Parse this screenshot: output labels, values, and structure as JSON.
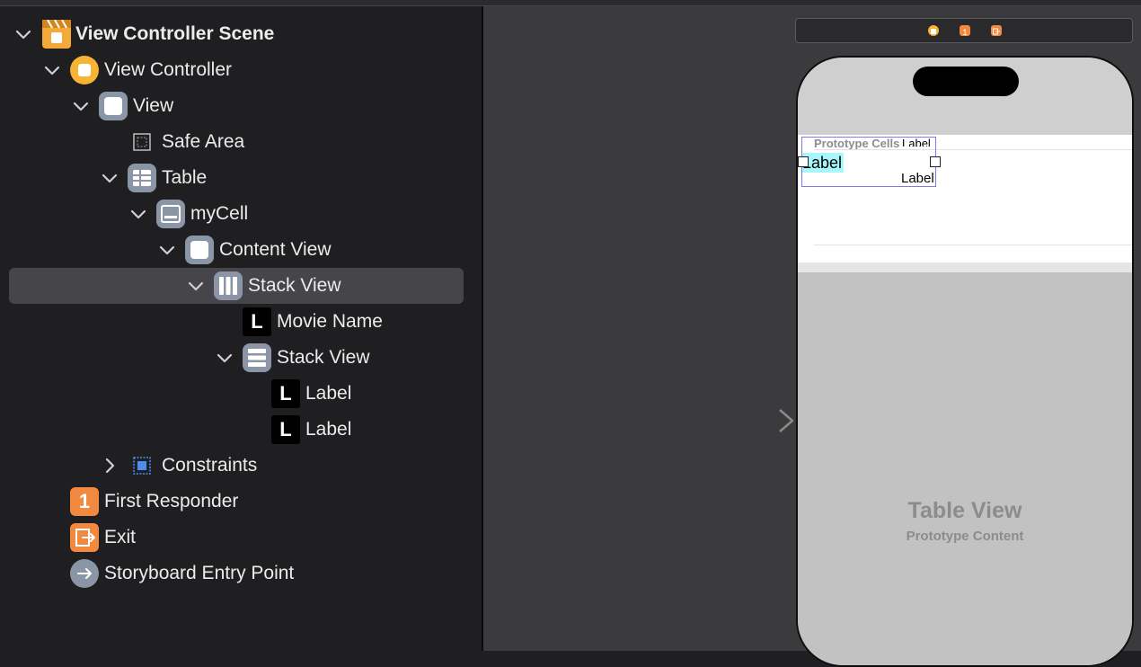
{
  "outline": {
    "items": [
      {
        "label": "View Controller Scene"
      },
      {
        "label": "View Controller"
      },
      {
        "label": "View"
      },
      {
        "label": "Safe Area"
      },
      {
        "label": "Table"
      },
      {
        "label": "myCell"
      },
      {
        "label": "Content View"
      },
      {
        "label": "Stack View"
      },
      {
        "label": "Movie Name"
      },
      {
        "label": "Stack View"
      },
      {
        "label": "Label"
      },
      {
        "label": "Label"
      },
      {
        "label": "Constraints"
      },
      {
        "label": "First Responder"
      },
      {
        "label": "Exit"
      },
      {
        "label": "Storyboard Entry Point"
      }
    ],
    "selected_label": "Stack View",
    "icon_letters": {
      "label": "L",
      "first_responder": "1"
    }
  },
  "canvas": {
    "prototype_cells": "Prototype Cells",
    "cell": {
      "movie_label": "Label",
      "label_top": "Label",
      "label_bottom": "Label"
    },
    "table_view_title": "Table View",
    "table_view_subtitle": "Prototype Content"
  },
  "colors": {
    "selection": "#46464a",
    "scene_icon": "#f4a93b",
    "view_controller_icon": "#f6b336",
    "first_responder_icon": "#f18a40",
    "object_icon": "#8a95a5",
    "stack_selection": "#7b7bea",
    "label_highlight": "#a7f6fb",
    "constraints_icon": "#4a8ef0"
  }
}
